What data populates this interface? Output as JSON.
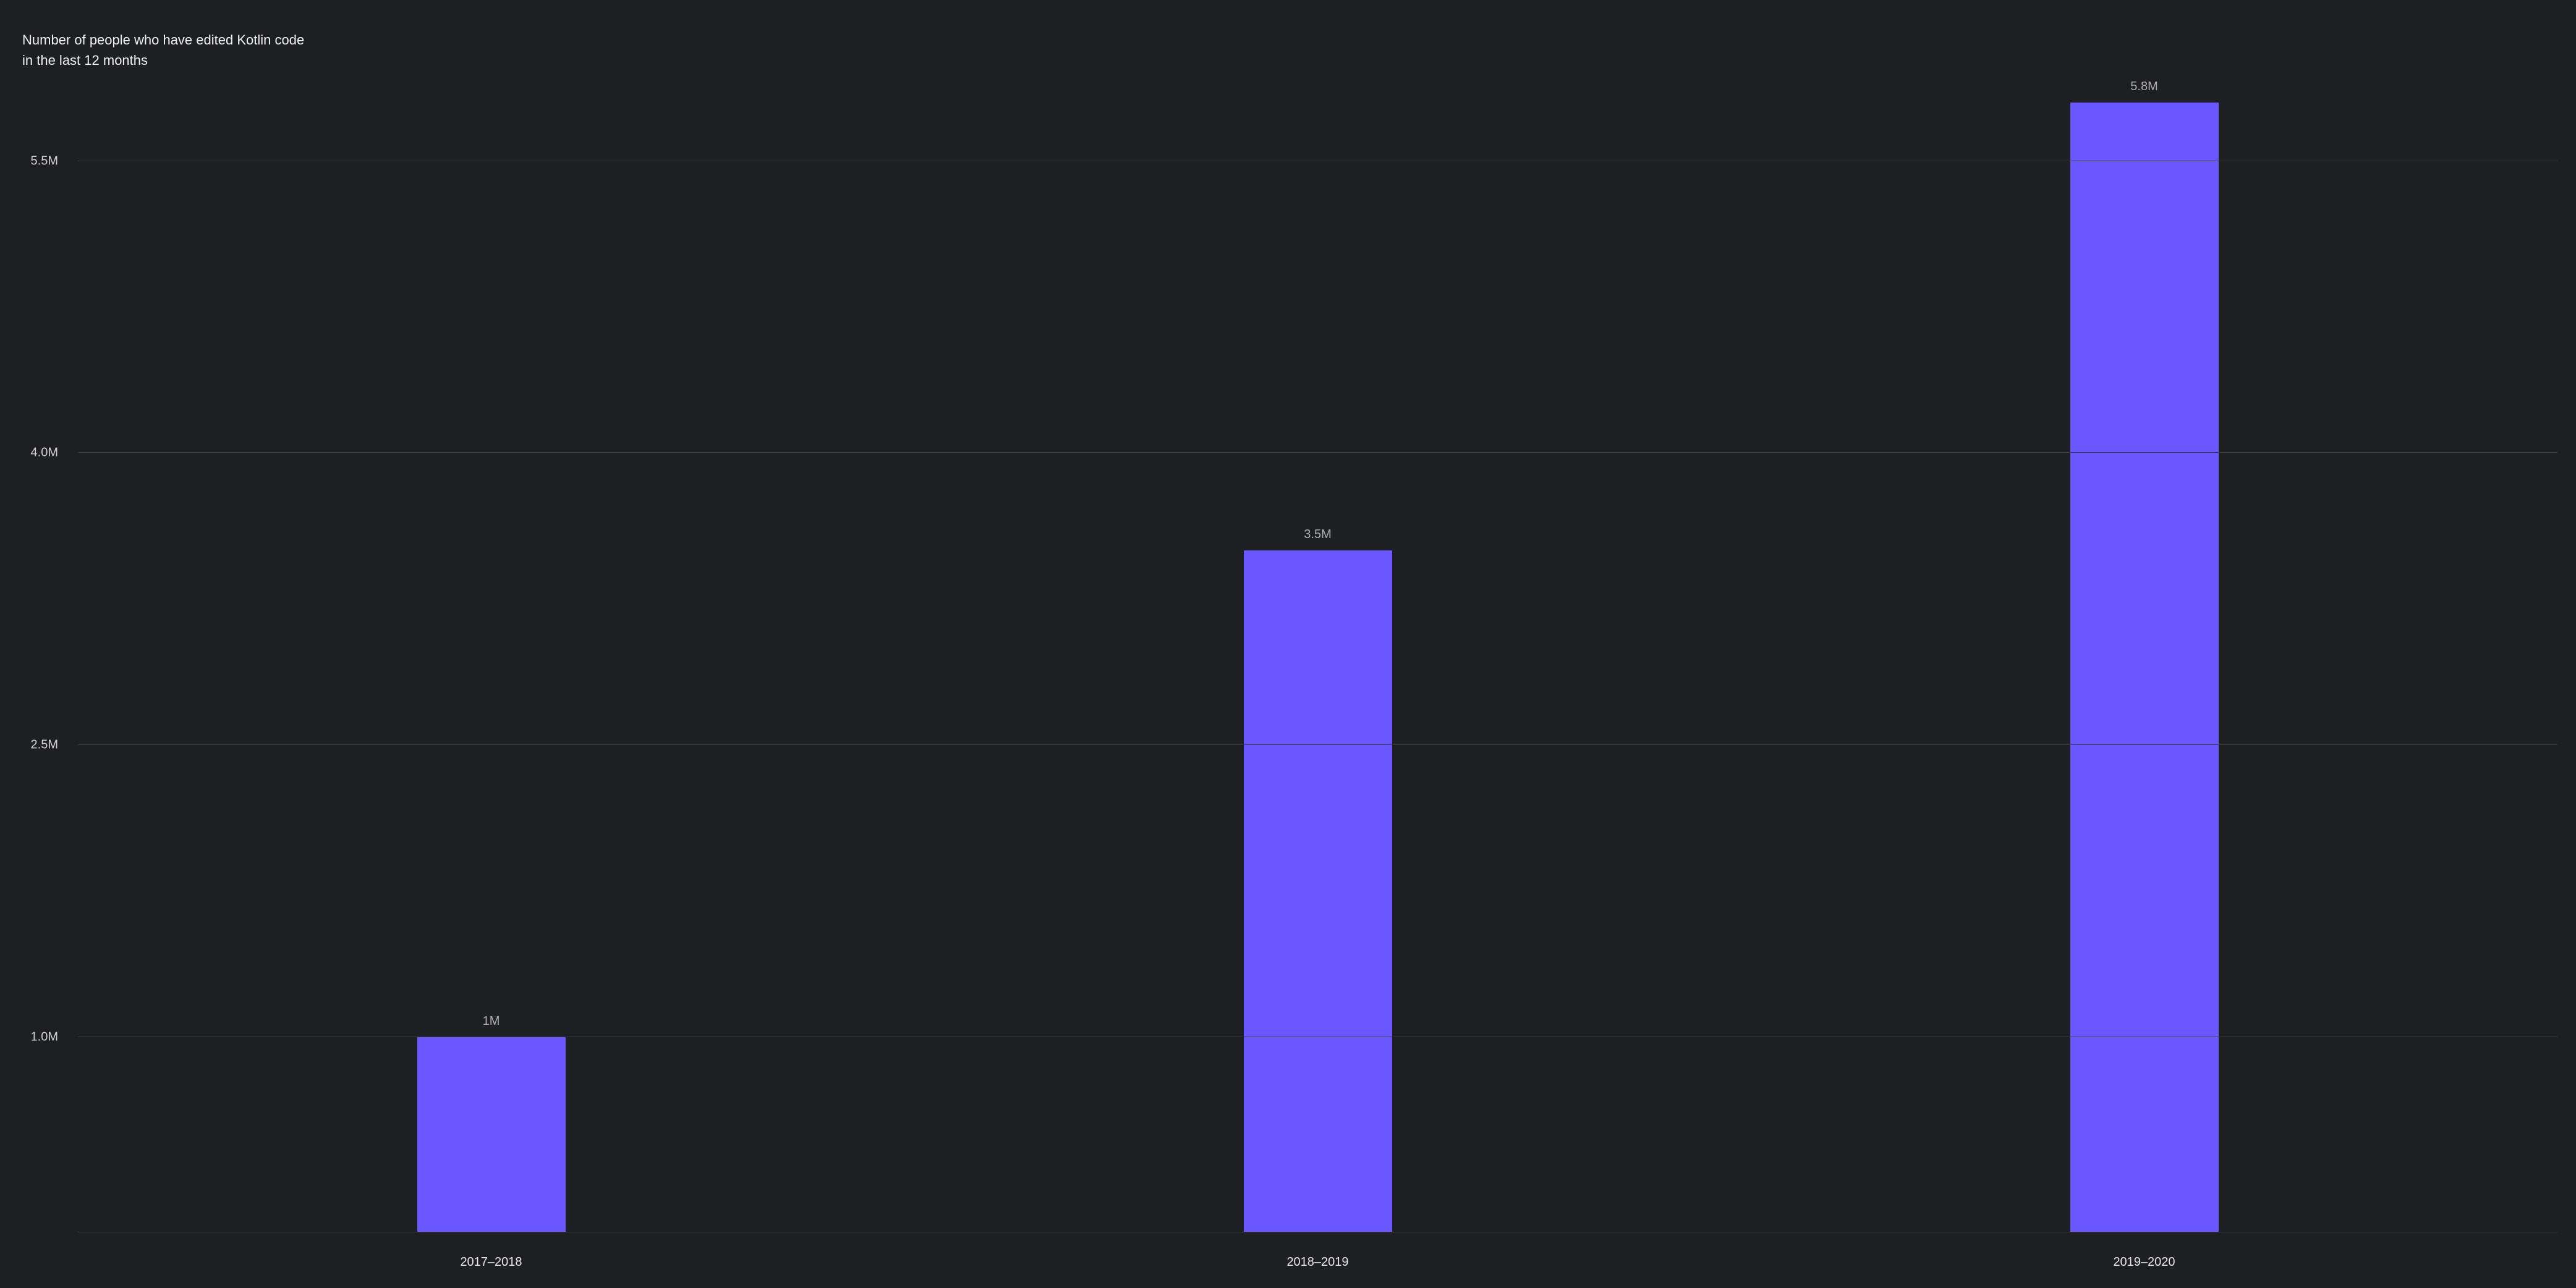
{
  "chart_data": {
    "type": "bar",
    "title": "Number of people who have edited Kotlin code in the last 12 months",
    "categories": [
      "2017–2018",
      "2018–2019",
      "2019–2020"
    ],
    "values": [
      1.0,
      3.5,
      5.8
    ],
    "value_labels": [
      "1M",
      "3.5M",
      "5.8M"
    ],
    "y_ticks": [
      1.0,
      2.5,
      4.0,
      5.5
    ],
    "y_tick_labels": [
      "1.0M",
      "2.5M",
      "4.0M",
      "5.5M"
    ],
    "ylim": [
      0,
      6.2
    ],
    "xlabel": "",
    "ylabel": "",
    "bar_color": "#6b57ff",
    "bg_color": "#1e1f22"
  }
}
